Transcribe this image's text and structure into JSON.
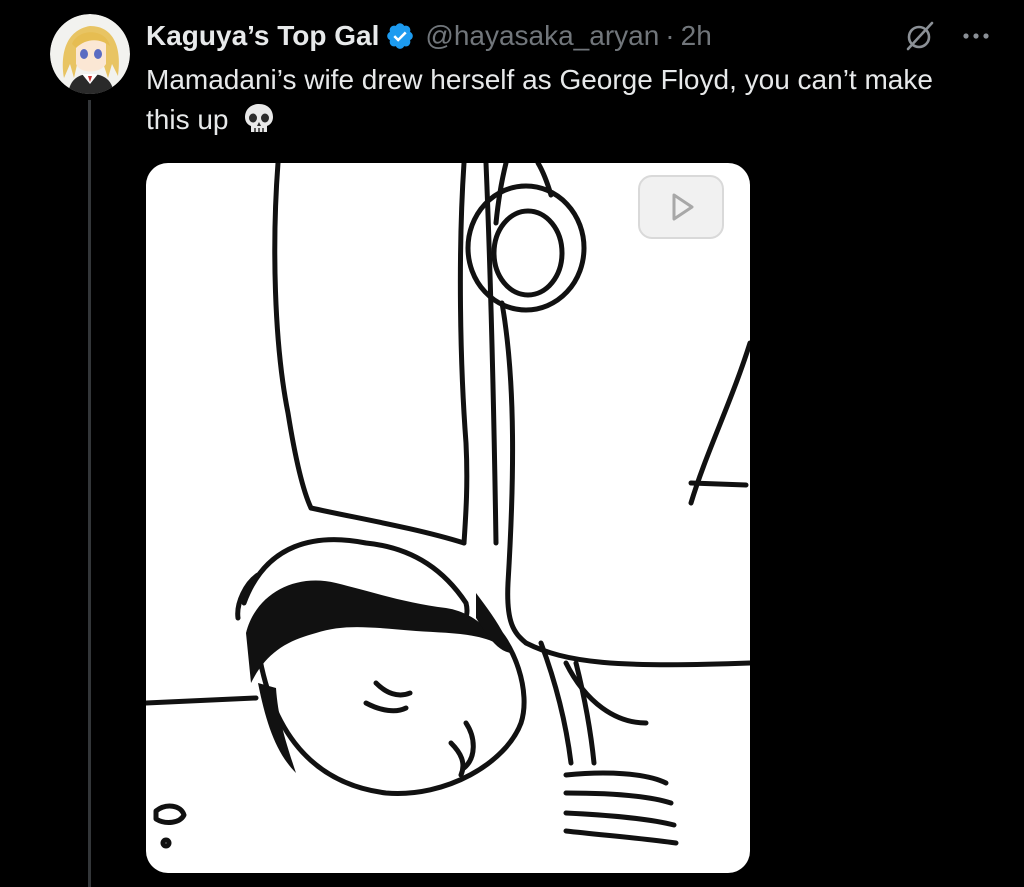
{
  "tweet": {
    "author": {
      "display_name": "Kaguya’s Top Gal",
      "handle": "@hayasaka_aryan",
      "verified": true
    },
    "separator": "·",
    "timestamp": "2h",
    "text": "Mamadani’s wife drew herself as George Floyd, you can’t make this up",
    "emoji": "skull",
    "media": {
      "type": "illustration",
      "has_play_badge": true
    }
  },
  "icons": {
    "verified": "verified-badge-icon",
    "grok": "grok-icon",
    "more": "more-icon",
    "skull": "skull-icon",
    "play": "play-icon"
  },
  "colors": {
    "background": "#000000",
    "primary_text": "#e7e9ea",
    "secondary_text": "#71767b",
    "verified_blue": "#1d9bf0",
    "thread_line": "#333639"
  }
}
